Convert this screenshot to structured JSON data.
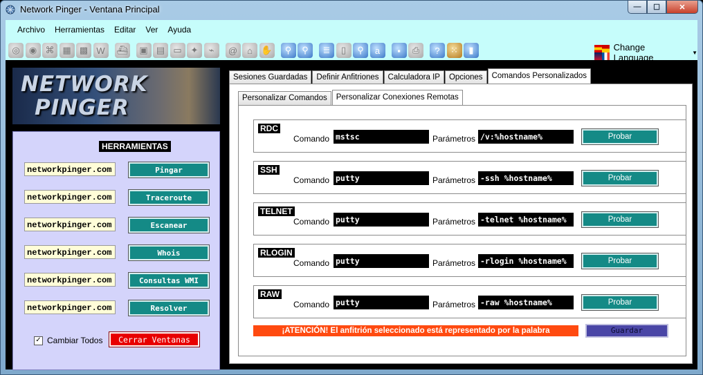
{
  "window": {
    "title": "Network Pinger - Ventana Principal",
    "buttons": {
      "minimize": "—",
      "maximize": "☐",
      "close": "✕"
    }
  },
  "menu": [
    "Archivo",
    "Herramientas",
    "Editar",
    "Ver",
    "Ayuda"
  ],
  "toolbar": {
    "icons": [
      "globe-icon",
      "search-globe-icon",
      "whois-icon",
      "scan-grid-icon",
      "network-grid-icon",
      "wmi-icon",
      "ship-icon",
      "network-computers-icon",
      "photo-icon",
      "monitor-icon",
      "satellite-icon",
      "plug-icon",
      "address-icon",
      "bank-icon",
      "hand-icon",
      "zoom-icon",
      "zoom-globe-icon",
      "server-stack-icon",
      "pages-icon",
      "search-page-icon",
      "text-a-icon",
      "floppy-save-icon",
      "printer-icon",
      "help-icon",
      "abacus-icon",
      "exit-door-icon"
    ],
    "change_language": "Change Language"
  },
  "logo": {
    "line1": "NETWORK",
    "line2": "PINGER"
  },
  "tools": {
    "title": "HERRAMIENTAS",
    "items": [
      {
        "host": "networkpinger.com",
        "button": "Pingar"
      },
      {
        "host": "networkpinger.com",
        "button": "Traceroute"
      },
      {
        "host": "networkpinger.com",
        "button": "Escanear"
      },
      {
        "host": "networkpinger.com",
        "button": "Whois"
      },
      {
        "host": "networkpinger.com",
        "button": "Consultas WMI"
      },
      {
        "host": "networkpinger.com",
        "button": "Resolver"
      }
    ],
    "change_all": "Cambiar Todos",
    "change_all_checked": "✓",
    "close_windows": "Cerrar Ventanas"
  },
  "tabs": [
    "Sesiones Guardadas",
    "Definir Anfitriones",
    "Calculadora IP",
    "Opciones",
    "Comandos Personalizados"
  ],
  "subtabs": [
    "Personalizar Comandos",
    "Personalizar Conexiones Remotas"
  ],
  "connections": {
    "command_label": "Comando",
    "params_label": "Parámetros",
    "test_label": "Probar",
    "rows": [
      {
        "name": "RDC",
        "command": "mstsc",
        "params": "/v:%hostname%"
      },
      {
        "name": "SSH",
        "command": "putty",
        "params": "-ssh %hostname%"
      },
      {
        "name": "TELNET",
        "command": "putty",
        "params": "-telnet %hostname%"
      },
      {
        "name": "RLOGIN",
        "command": "putty",
        "params": "-rlogin %hostname%"
      },
      {
        "name": "RAW",
        "command": "putty",
        "params": "-raw %hostname%"
      }
    ],
    "warning": "¡ATENCIÓN! El anfitrión seleccionado está representado por la palabra",
    "save": "Guardar"
  }
}
